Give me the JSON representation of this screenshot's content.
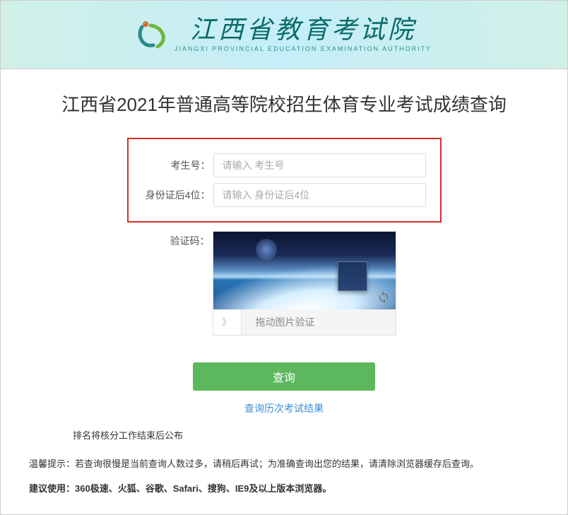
{
  "header": {
    "org_name_cn": "江西省教育考试院",
    "org_name_en": "JIANGXI PROVINCIAL EDUCATION EXAMINATION AUTHORITY"
  },
  "page": {
    "title": "江西省2021年普通高等院校招生体育专业考试成绩查询"
  },
  "form": {
    "candidate_label": "考生号：",
    "candidate_placeholder": "请输入 考生号",
    "idcard_label": "身份证后4位：",
    "idcard_placeholder": "请输入 身份证后4位",
    "captcha_label": "验证码：",
    "slider_hint": "拖动图片验证",
    "submit_text": "查询"
  },
  "links": {
    "history": "查询历次考试结果"
  },
  "notes": {
    "ranking": "排名将核分工作结束后公布",
    "tip1": "温馨提示：若查询很慢是当前查询人数过多，请稍后再试；为准确查询出您的结果，请清除浏览器缓存后查询。",
    "tip2": "建议使用：360极速、火狐、谷歌、Safari、搜狗、IE9及以上版本浏览器。"
  }
}
